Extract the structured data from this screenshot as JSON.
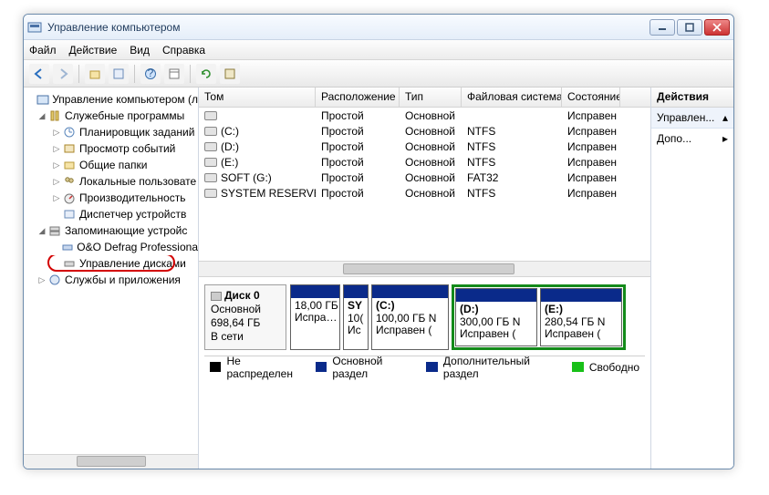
{
  "window": {
    "title": "Управление компьютером"
  },
  "menu": {
    "file": "Файл",
    "action": "Действие",
    "view": "Вид",
    "help": "Справка"
  },
  "tree": {
    "root": "Управление компьютером (л",
    "n1": "Служебные программы",
    "n1_1": "Планировщик заданий",
    "n1_2": "Просмотр событий",
    "n1_3": "Общие папки",
    "n1_4": "Локальные пользовате",
    "n1_5": "Производительность",
    "n1_6": "Диспетчер устройств",
    "n2": "Запоминающие устройс",
    "n2_1": "O&O Defrag Professionа",
    "n2_2": "Управление дисками",
    "n3": "Службы и приложения"
  },
  "vol": {
    "h": {
      "c0": "Том",
      "c1": "Расположение",
      "c2": "Тип",
      "c3": "Файловая система",
      "c4": "Состояние"
    },
    "r": [
      {
        "c0": "",
        "c1": "Простой",
        "c2": "Основной",
        "c3": "",
        "c4": "Исправен"
      },
      {
        "c0": "(C:)",
        "c1": "Простой",
        "c2": "Основной",
        "c3": "NTFS",
        "c4": "Исправен"
      },
      {
        "c0": "(D:)",
        "c1": "Простой",
        "c2": "Основной",
        "c3": "NTFS",
        "c4": "Исправен"
      },
      {
        "c0": "(E:)",
        "c1": "Простой",
        "c2": "Основной",
        "c3": "NTFS",
        "c4": "Исправен"
      },
      {
        "c0": "SOFT (G:)",
        "c1": "Простой",
        "c2": "Основной",
        "c3": "FAT32",
        "c4": "Исправен"
      },
      {
        "c0": "SYSTEM RESERVED",
        "c1": "Простой",
        "c2": "Основной",
        "c3": "NTFS",
        "c4": "Исправен"
      }
    ]
  },
  "disk": {
    "name": "Диск 0",
    "type": "Основной",
    "size": "698,64 ГБ",
    "status": "В сети",
    "p": [
      {
        "l1": "",
        "l2": "18,00 ГБ",
        "l3": "Испра…"
      },
      {
        "l1": "SY",
        "l2": "10(",
        "l3": "Ис"
      },
      {
        "l1": "(C:)",
        "l2": "100,00 ГБ N",
        "l3": "Исправен ("
      },
      {
        "l1": "(D:)",
        "l2": "300,00 ГБ N",
        "l3": "Исправен ("
      },
      {
        "l1": "(E:)",
        "l2": "280,54 ГБ N",
        "l3": "Исправен ("
      }
    ]
  },
  "legend": {
    "a": "Не распределен",
    "b": "Основной раздел",
    "c": "Дополнительный раздел",
    "d": "Свободно"
  },
  "actions": {
    "h": "Действия",
    "a": "Управлен...",
    "b": "Допо..."
  }
}
